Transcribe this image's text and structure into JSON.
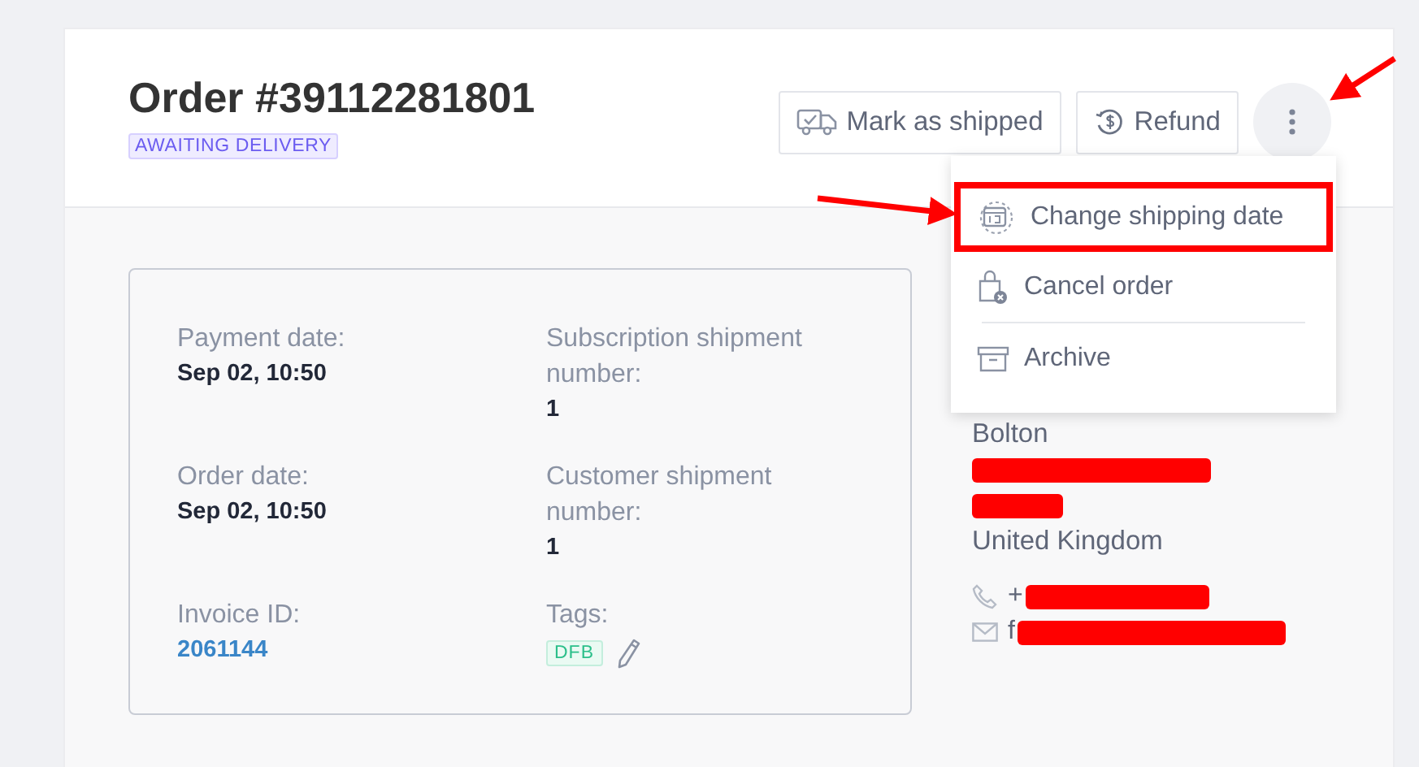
{
  "order": {
    "title": "Order #39112281801",
    "status": "AWAITING DELIVERY"
  },
  "actions": [
    {
      "kind": "truck",
      "label": "Mark as shipped"
    },
    {
      "kind": "refund",
      "label": "Refund"
    },
    {
      "kind": "more",
      "expanded": true
    }
  ],
  "menu": {
    "items": [
      {
        "kind": "calendar",
        "label": "Change shipping date",
        "highlighted": true
      },
      {
        "kind": "cancel",
        "label": "Cancel order",
        "highlighted": false
      },
      {
        "kind": "divider"
      },
      {
        "kind": "archive",
        "label": "Archive",
        "highlighted": false
      }
    ]
  },
  "details": {
    "fields": [
      {
        "label": "Payment date:",
        "value": "Sep 02, 10:50",
        "kind": "text"
      },
      {
        "label": "Subscription shipment number:",
        "value": "1",
        "kind": "text"
      },
      {
        "label": "Order date:",
        "value": "Sep 02, 10:50",
        "kind": "text"
      },
      {
        "label": "Customer shipment number:",
        "value": "1",
        "kind": "text"
      },
      {
        "label": "Invoice ID:",
        "value": "2061144",
        "kind": "link"
      },
      {
        "label": "Tags:",
        "kind": "tags",
        "tags": [
          "DFB"
        ]
      }
    ]
  },
  "address": {
    "lines": [
      {
        "kind": "text",
        "text": "Bolton"
      },
      {
        "kind": "redacted"
      },
      {
        "kind": "redacted"
      },
      {
        "kind": "text",
        "text": "United Kingdom"
      }
    ],
    "contacts": [
      {
        "kind": "phone",
        "text": "+"
      },
      {
        "kind": "email",
        "text": "f"
      }
    ]
  },
  "annotations": [
    {
      "kind": "arrow"
    },
    {
      "kind": "arrow"
    }
  ]
}
